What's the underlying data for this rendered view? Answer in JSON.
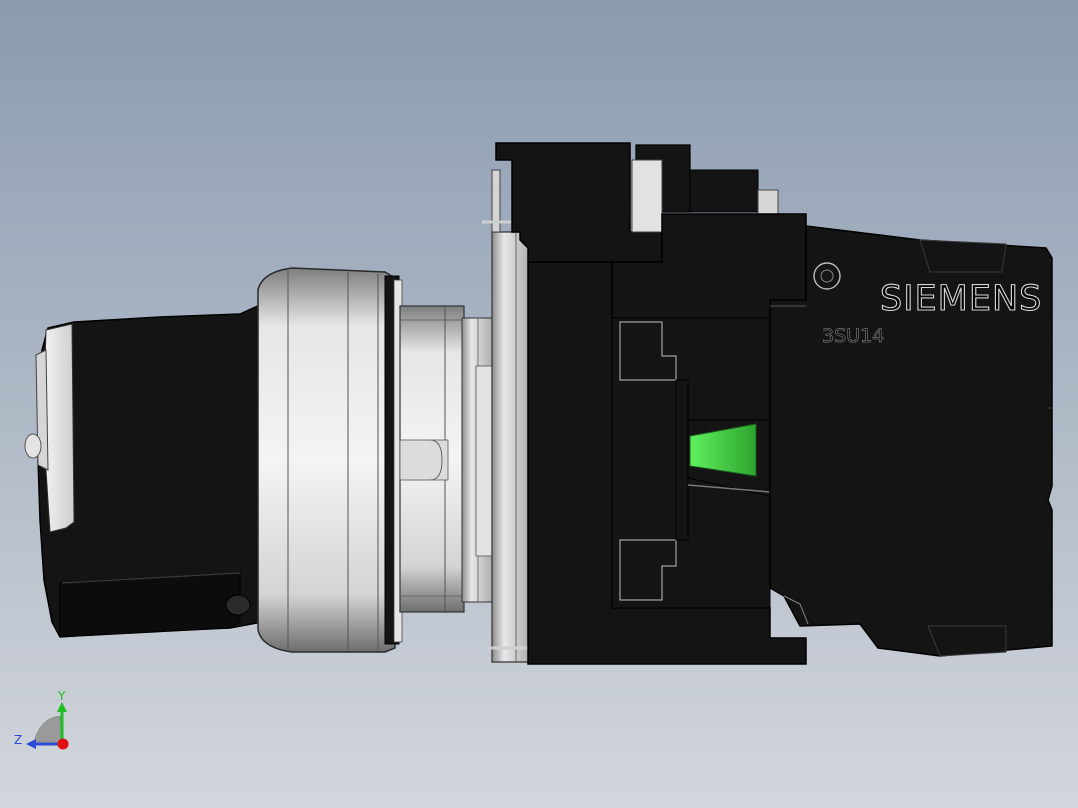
{
  "model": {
    "brand_text": "SIEMENS",
    "part_code": "3SU14"
  },
  "triad": {
    "y_label": "Y",
    "z_label": "Z",
    "y_color": "#1fbf1f",
    "z_color": "#2a4bd6",
    "x_color": "#e01010"
  },
  "colors": {
    "background_top": "#8a9bb0",
    "background_bottom": "#d3d6dc",
    "body": "#141414",
    "metal": "#c9c9c9",
    "indicator": "#5ef05e"
  }
}
